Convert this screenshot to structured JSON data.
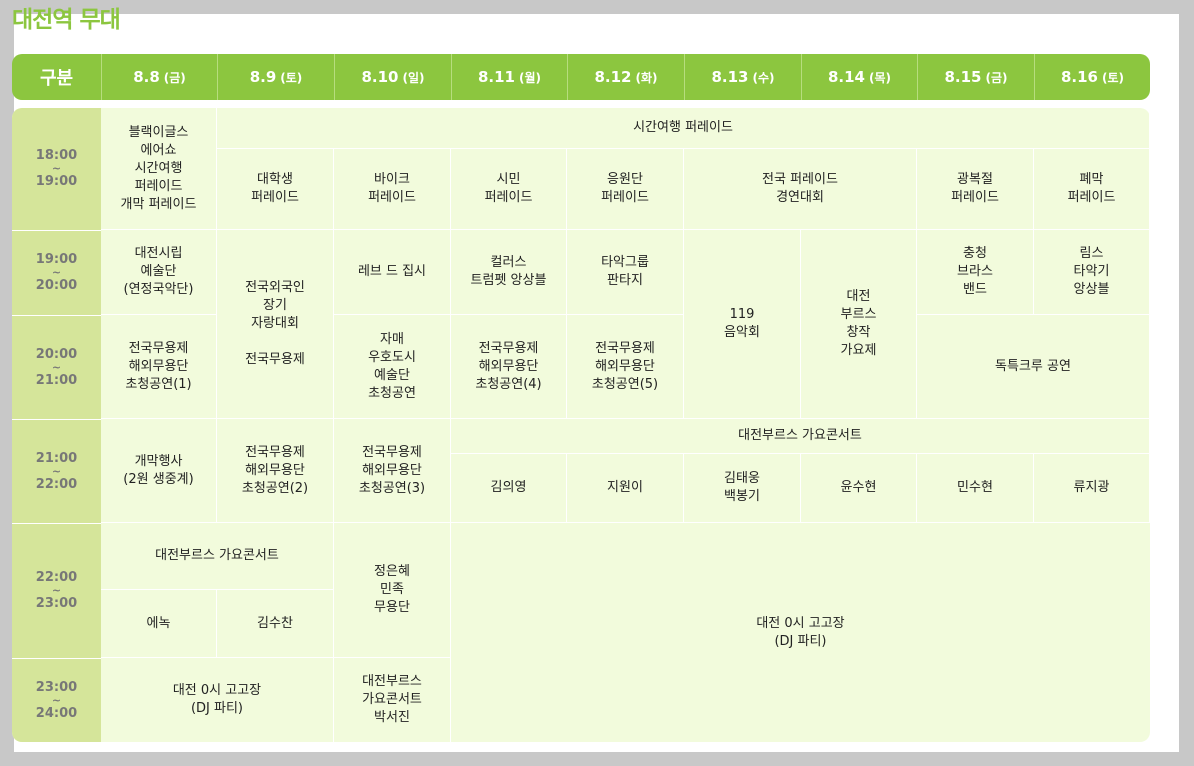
{
  "title": "대전역 무대",
  "colors": {
    "accent": "#8cc63f",
    "body": "#f2fbdc",
    "timecol": "#d5e59a"
  },
  "header": {
    "corner": "구분",
    "dates": [
      {
        "date": "8.8",
        "day": "(금)"
      },
      {
        "date": "8.9",
        "day": "(토)"
      },
      {
        "date": "8.10",
        "day": "(일)"
      },
      {
        "date": "8.11",
        "day": "(월)"
      },
      {
        "date": "8.12",
        "day": "(화)"
      },
      {
        "date": "8.13",
        "day": "(수)"
      },
      {
        "date": "8.14",
        "day": "(목)"
      },
      {
        "date": "8.15",
        "day": "(금)"
      },
      {
        "date": "8.16",
        "day": "(토)"
      }
    ]
  },
  "times": [
    {
      "start": "18:00",
      "sep": "~",
      "end": "19:00"
    },
    {
      "start": "19:00",
      "sep": "~",
      "end": "20:00"
    },
    {
      "start": "20:00",
      "sep": "~",
      "end": "21:00"
    },
    {
      "start": "21:00",
      "sep": "~",
      "end": "22:00"
    },
    {
      "start": "22:00",
      "sep": "~",
      "end": "23:00"
    },
    {
      "start": "23:00",
      "sep": "~",
      "end": "24:00"
    }
  ],
  "cells": {
    "blackeagles": "블랙이글스\n에어쇼\n시간여행\n퍼레이드\n개막 퍼레이드",
    "time_travel_parade": "시간여행 퍼레이드",
    "univ_parade": "대학생\n퍼레이드",
    "bike_parade": "바이크\n퍼레이드",
    "citizen_parade": "시민\n퍼레이드",
    "cheer_parade": "응원단\n퍼레이드",
    "national_parade": "전국 퍼레이드\n경연대회",
    "liberation_parade": "광복절\n퍼레이드",
    "closing_parade": "폐막\n퍼레이드",
    "daejeon_orchestra": "대전시립\n예술단\n(연정국악단)",
    "foreigner_contest": "전국외국인\n장기\n자랑대회\n\n전국무용제",
    "reve_gypsy": "레브 드 집시",
    "colors_trumpet": "컬러스\n트럼펫 앙상블",
    "percussion_fantasy": "타악그룹\n판타지",
    "fire_concert": "119\n음악회",
    "bruce_song": "대전\n부르스\n창작\n가요제",
    "chungcheong_brass": "충청\n브라스\n밴드",
    "rhythm_ensemble": "림스\n타악기\n앙상블",
    "dance_invite_1": "전국무용제\n해외무용단\n초청공연(1)",
    "sister_city": "자매\n우호도시\n예술단\n초청공연",
    "dance_invite_4": "전국무용제\n해외무용단\n초청공연(4)",
    "dance_invite_5": "전국무용제\n해외무용단\n초청공연(5)",
    "dokteuk_crew": "독특크루 공연",
    "opening_event": "개막행사\n(2원 생중계)",
    "dance_invite_2": "전국무용제\n해외무용단\n초청공연(2)",
    "dance_invite_3": "전국무용제\n해외무용단\n초청공연(3)",
    "bruce_concert_21": "대전부르스 가요콘서트",
    "kim_euiyoung": "김의영",
    "jiwon": "지원이",
    "kim_taewoong": "김태웅\n백봉기",
    "yoon_suhyun": "윤수현",
    "min_suhyun": "민수현",
    "ryu_jigwang": "류지광",
    "bruce_concert_22": "대전부르스 가요콘서트",
    "enok": "에녹",
    "kim_suchan": "김수찬",
    "jung_eunhye": "정은혜\n민족\n무용단",
    "zero_oclock_big": "대전 0시 고고장\n(DJ 파티)",
    "zero_oclock_small": "대전 0시 고고장\n(DJ 파티)",
    "bruce_concert_park": "대전부르스\n가요콘서트\n박서진"
  }
}
